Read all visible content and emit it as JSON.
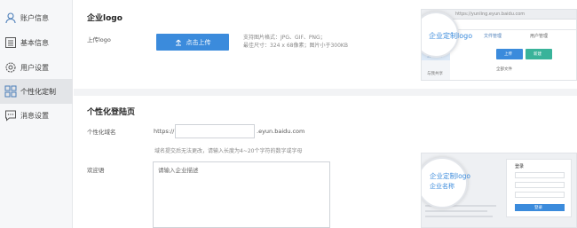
{
  "sidebar": {
    "items": [
      {
        "label": "账户信息",
        "icon": "user-icon"
      },
      {
        "label": "基本信息",
        "icon": "list-icon"
      },
      {
        "label": "用户设置",
        "icon": "gear-icon"
      },
      {
        "label": "个性化定制",
        "icon": "grid-icon",
        "active": true
      },
      {
        "label": "消息设置",
        "icon": "message-icon"
      }
    ]
  },
  "logo_section": {
    "title": "企业logo",
    "field_label": "上传logo",
    "upload_button": "点击上传",
    "hint_line1": "支持图片格式：JPG、GIF、PNG；",
    "hint_line2": "最佳尺寸：324 x 68像素；图片小于300KB"
  },
  "login_section": {
    "title": "个性化登陆页",
    "domain_label": "个性化域名",
    "domain_prefix": "https://",
    "domain_value": "",
    "domain_suffix": ".eyun.baidu.com",
    "domain_hint": "域名提交后无法更改，请输入长度为4~20个字符的数字或字母",
    "welcome_label": "欢迎语",
    "welcome_placeholder": "请输入企业描述"
  },
  "preview1": {
    "url_text": "https://yunling.eyun.baidu.com",
    "logo_text": "企业定制logo",
    "tab1": "文件管理",
    "tab2": "用户管理",
    "side1": "我的文件",
    "side2": "与我共享",
    "list_head": "全部文件",
    "btn1": "上传",
    "btn2": "新建"
  },
  "preview2": {
    "logo_text": "企业定制logo",
    "company_text": "企业名称",
    "login_title": "登录",
    "login_btn": "登录"
  },
  "colors": {
    "accent": "#3b8bdc",
    "green": "#39b39a"
  }
}
